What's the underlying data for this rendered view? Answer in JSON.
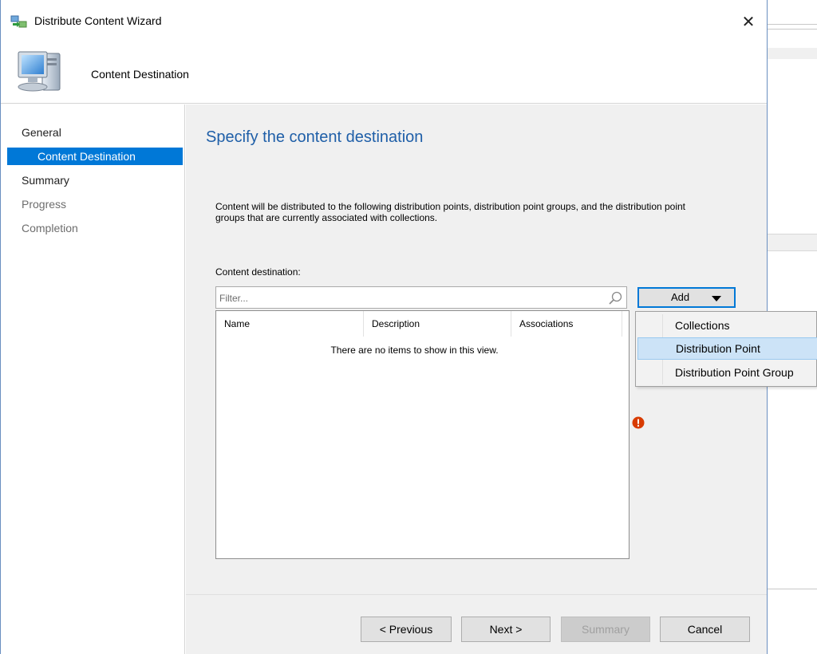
{
  "window": {
    "title": "Distribute Content Wizard",
    "close_glyph": "✕"
  },
  "header": {
    "title": "Content Destination",
    "icon": "computer-icon"
  },
  "nav": {
    "items": [
      {
        "label": "General",
        "state": "normal"
      },
      {
        "label": "Content Destination",
        "state": "active"
      },
      {
        "label": "Summary",
        "state": "normal"
      },
      {
        "label": "Progress",
        "state": "disabled"
      },
      {
        "label": "Completion",
        "state": "disabled"
      }
    ]
  },
  "content": {
    "title": "Specify the content destination",
    "description": "Content will be distributed to the following distribution points, distribution point groups, and the distribution point groups that are currently associated with collections.",
    "destination_label": "Content destination:",
    "filter_placeholder": "Filter...",
    "columns": [
      "Name",
      "Description",
      "Associations"
    ],
    "empty_message": "There are no items to show in this view.",
    "add_button": "Add"
  },
  "add_menu": {
    "items": [
      "Collections",
      "Distribution Point",
      "Distribution Point Group"
    ],
    "highlighted": "Distribution Point"
  },
  "buttons": {
    "previous": "< Previous",
    "next": "Next >",
    "summary": "Summary",
    "cancel": "Cancel"
  },
  "colors": {
    "accent": "#0078d7",
    "title_blue": "#1f5fa8",
    "error": "#d83b01"
  }
}
